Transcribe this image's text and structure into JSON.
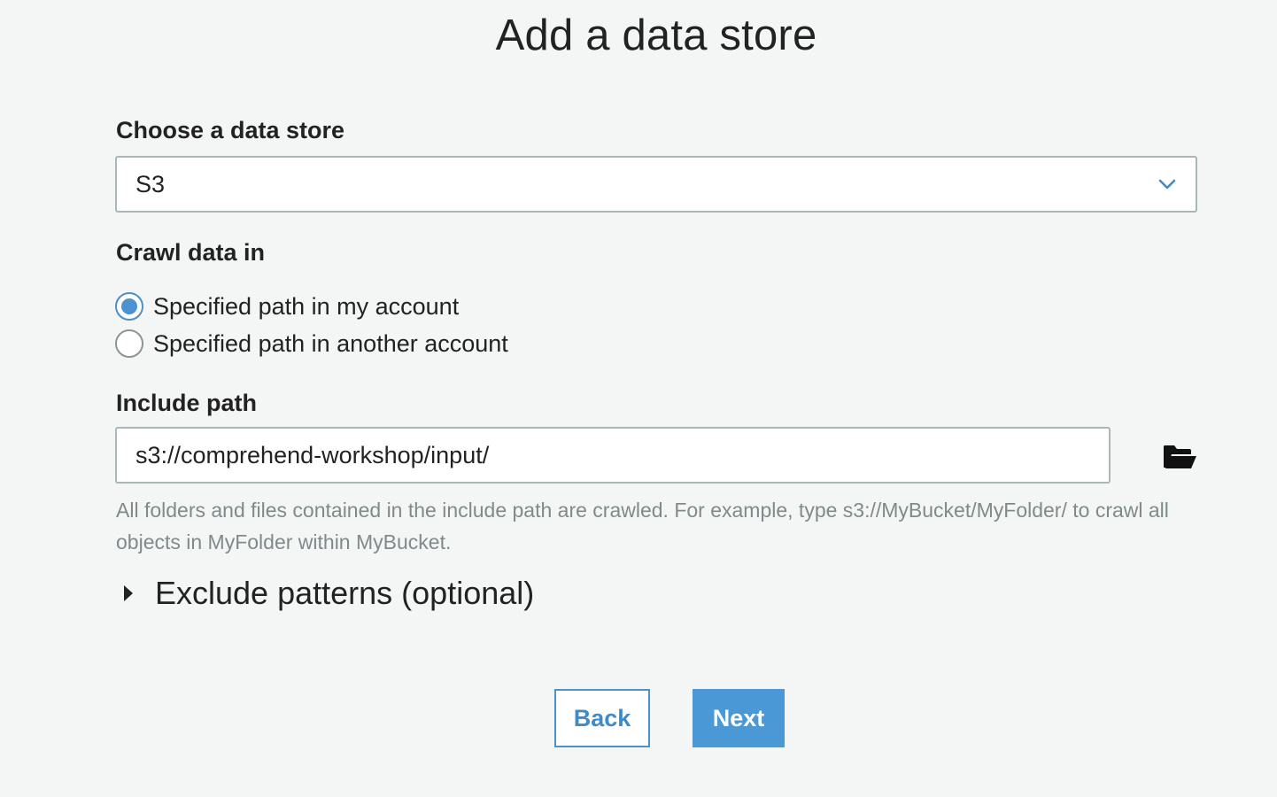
{
  "page": {
    "title": "Add a data store"
  },
  "data_store": {
    "label": "Choose a data store",
    "selected": "S3",
    "chevron_icon": "chevron-down-icon"
  },
  "crawl": {
    "label": "Crawl data in",
    "options": [
      {
        "label": "Specified path in my account",
        "checked": true
      },
      {
        "label": "Specified path in another account",
        "checked": false
      }
    ]
  },
  "include_path": {
    "label": "Include path",
    "value": "s3://comprehend-workshop/input/",
    "browse_icon": "folder-open-icon",
    "help": "All folders and files contained in the include path are crawled. For example, type s3://MyBucket/MyFolder/ to crawl all objects in MyFolder within MyBucket."
  },
  "exclude": {
    "label": "Exclude patterns (optional)",
    "expanded": false
  },
  "buttons": {
    "back": "Back",
    "next": "Next"
  },
  "colors": {
    "accent": "#4a98d6",
    "background": "#f4f6f5",
    "border": "#aab7b8",
    "help_text": "#7f8a8b"
  }
}
